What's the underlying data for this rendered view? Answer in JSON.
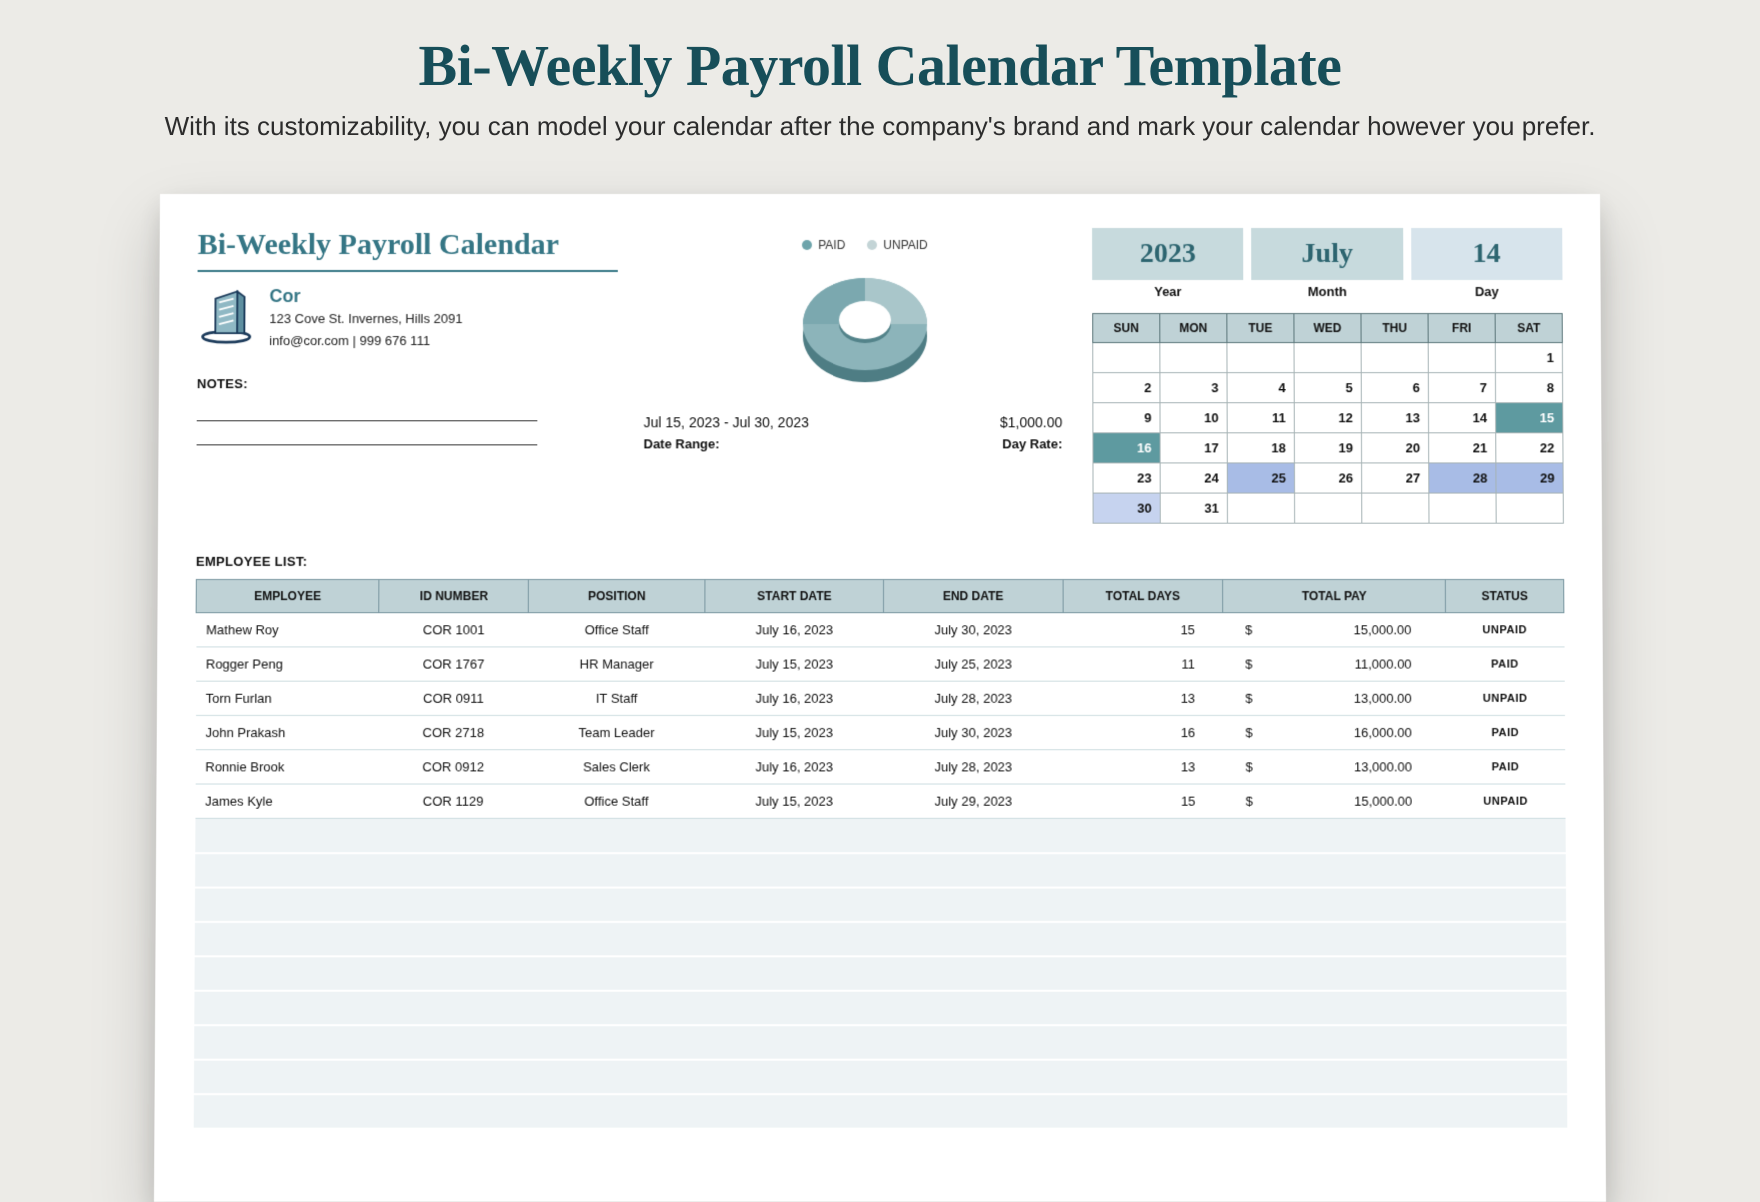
{
  "page": {
    "title": "Bi-Weekly Payroll Calendar Template",
    "subtitle": "With its customizability, you can model your calendar after the company's brand and mark your calendar however you prefer."
  },
  "doc": {
    "title": "Bi-Weekly Payroll Calendar",
    "company_name": "Cor",
    "company_address": "123 Cove St. Invernes, Hills 2091",
    "company_contact": "info@cor.com | 999 676 111",
    "notes_label": "NOTES:",
    "employee_list_label": "EMPLOYEE LIST:"
  },
  "chart": {
    "legend_paid": "PAID",
    "legend_unpaid": "UNPAID",
    "date_range_value": "Jul 15, 2023 - Jul 30, 2023",
    "day_rate_value": "$1,000.00",
    "date_range_label": "Date Range:",
    "day_rate_label": "Day Rate:"
  },
  "date": {
    "year": "2023",
    "month": "July",
    "day": "14",
    "year_label": "Year",
    "month_label": "Month",
    "day_label": "Day"
  },
  "cal": {
    "dow": [
      "SUN",
      "MON",
      "TUE",
      "WED",
      "THU",
      "FRI",
      "SAT"
    ]
  },
  "table": {
    "headers": [
      "EMPLOYEE",
      "ID NUMBER",
      "POSITION",
      "START DATE",
      "END DATE",
      "TOTAL DAYS",
      "TOTAL PAY",
      "STATUS"
    ],
    "rows": [
      {
        "employee": "Mathew Roy",
        "id": "COR 1001",
        "position": "Office Staff",
        "start": "July 16, 2023",
        "end": "July 30, 2023",
        "days": "15",
        "pay": "15,000.00",
        "status": "UNPAID"
      },
      {
        "employee": "Rogger Peng",
        "id": "COR 1767",
        "position": "HR Manager",
        "start": "July 15, 2023",
        "end": "July 25, 2023",
        "days": "11",
        "pay": "11,000.00",
        "status": "PAID"
      },
      {
        "employee": "Torn Furlan",
        "id": "COR 0911",
        "position": "IT Staff",
        "start": "July 16, 2023",
        "end": "July 28, 2023",
        "days": "13",
        "pay": "13,000.00",
        "status": "UNPAID"
      },
      {
        "employee": "John Prakash",
        "id": "COR 2718",
        "position": "Team Leader",
        "start": "July 15, 2023",
        "end": "July 30, 2023",
        "days": "16",
        "pay": "16,000.00",
        "status": "PAID"
      },
      {
        "employee": "Ronnie Brook",
        "id": "COR 0912",
        "position": "Sales Clerk",
        "start": "July 16, 2023",
        "end": "July 28, 2023",
        "days": "13",
        "pay": "13,000.00",
        "status": "PAID"
      },
      {
        "employee": "James Kyle",
        "id": "COR  1129",
        "position": "Office Staff",
        "start": "July 15, 2023",
        "end": "July 29, 2023",
        "days": "15",
        "pay": "15,000.00",
        "status": "UNPAID"
      }
    ]
  },
  "chart_data": {
    "type": "pie",
    "title": "Paid vs Unpaid",
    "series": [
      {
        "name": "PAID",
        "value": 3,
        "color": "#6da4ab"
      },
      {
        "name": "UNPAID",
        "value": 3,
        "color": "#b9cccf"
      }
    ]
  }
}
